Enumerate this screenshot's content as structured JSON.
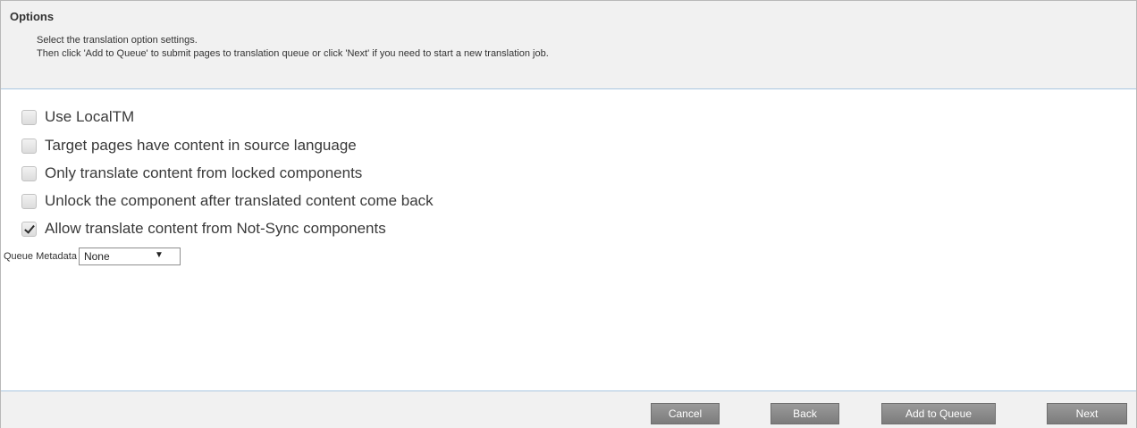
{
  "header": {
    "title": "Options",
    "line1": "Select the translation option settings.",
    "line2": "Then click 'Add to Queue' to submit pages to translation queue or click 'Next' if you need to start a new translation job."
  },
  "options": [
    {
      "label": "Use LocalTM",
      "checked": false
    },
    {
      "label": "Target pages have content in source language",
      "checked": false
    },
    {
      "label": "Only translate content from locked components",
      "checked": false
    },
    {
      "label": "Unlock the component after translated content come back",
      "checked": false
    },
    {
      "label": "Allow translate content from Not-Sync components",
      "checked": true
    }
  ],
  "queue_metadata": {
    "label": "Queue Metadata",
    "selected": "None",
    "arrow": "▼"
  },
  "footer": {
    "cancel_label": "Cancel",
    "back_label": "Back",
    "add_to_queue_label": "Add to Queue",
    "next_label": "Next"
  }
}
